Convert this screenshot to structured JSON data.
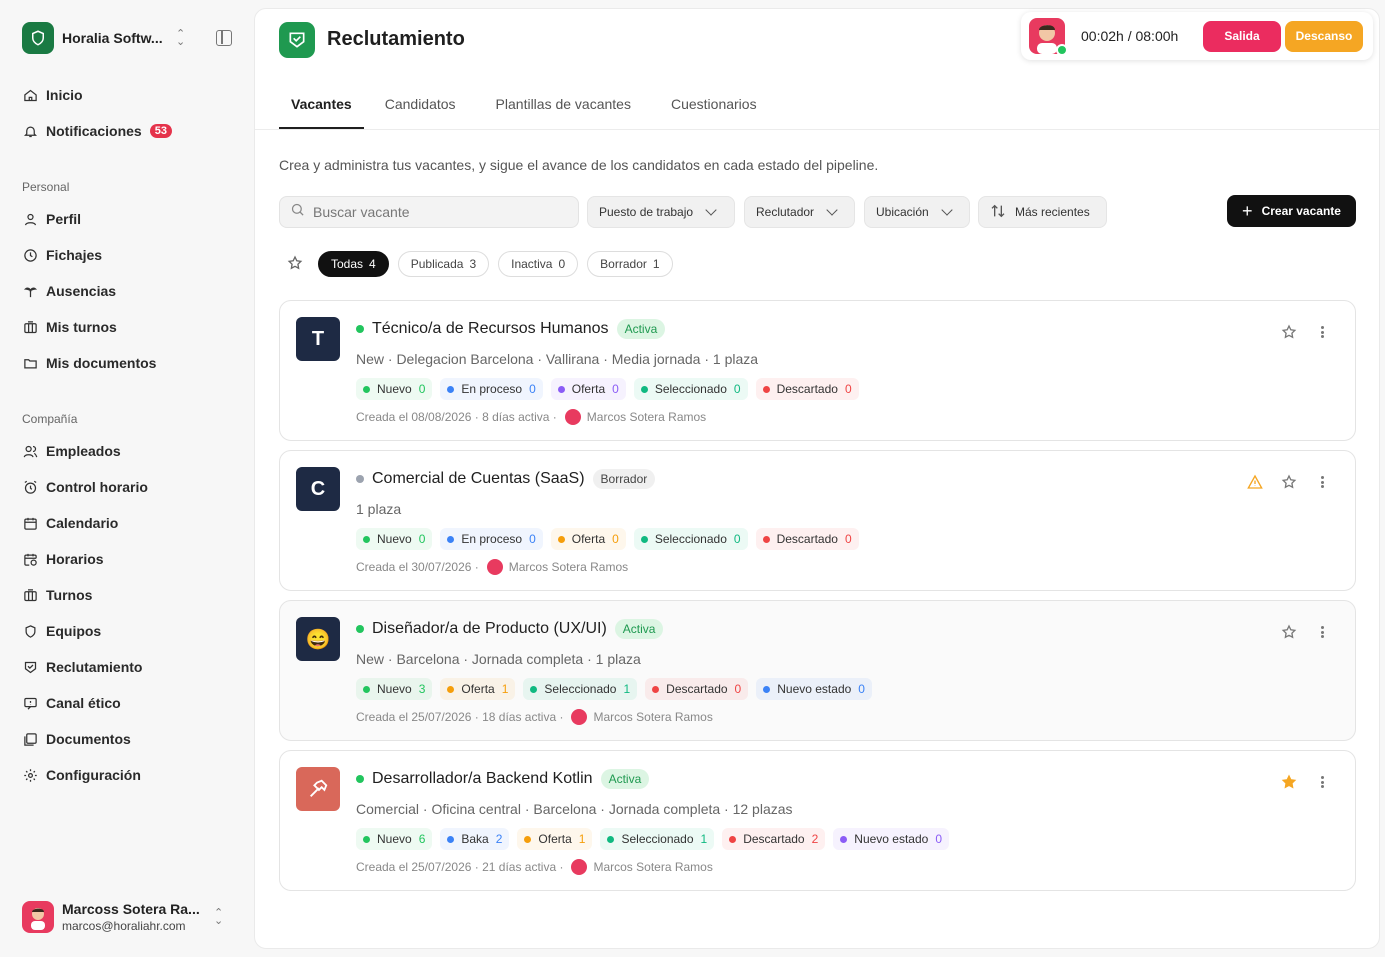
{
  "sidebar": {
    "workspace": "Horalia Softw...",
    "nav_top": [
      {
        "label": "Inicio",
        "icon": "home-icon"
      },
      {
        "label": "Notificaciones",
        "icon": "bell-icon",
        "badge": "53"
      }
    ],
    "section_personal": "Personal",
    "personal": [
      {
        "label": "Perfil",
        "icon": "user-icon"
      },
      {
        "label": "Fichajes",
        "icon": "clock-icon"
      },
      {
        "label": "Ausencias",
        "icon": "palm-tree-icon"
      },
      {
        "label": "Mis turnos",
        "icon": "shifts-icon"
      },
      {
        "label": "Mis documentos",
        "icon": "folder-icon"
      }
    ],
    "section_company": "Compañía",
    "company": [
      {
        "label": "Empleados",
        "icon": "users-icon"
      },
      {
        "label": "Control horario",
        "icon": "alarm-clock-icon"
      },
      {
        "label": "Calendario",
        "icon": "calendar-icon"
      },
      {
        "label": "Horarios",
        "icon": "calendar-clock-icon"
      },
      {
        "label": "Turnos",
        "icon": "shifts-icon"
      },
      {
        "label": "Equipos",
        "icon": "shield-icon"
      },
      {
        "label": "Reclutamiento",
        "icon": "handshake-icon"
      },
      {
        "label": "Canal ético",
        "icon": "message-icon"
      },
      {
        "label": "Documentos",
        "icon": "documents-icon"
      },
      {
        "label": "Configuración",
        "icon": "gear-icon"
      }
    ],
    "user": {
      "name": "Marcoss Sotera Ra...",
      "email": "marcos@horaliahr.com"
    }
  },
  "header": {
    "title": "Reclutamiento",
    "timer": "00:02h / 08:00h",
    "salida": "Salida",
    "descanso": "Descanso"
  },
  "tabs": [
    "Vacantes",
    "Candidatos",
    "Plantillas de vacantes",
    "Cuestionarios"
  ],
  "description": "Crea y administra tus vacantes, y sigue el avance de los candidatos en cada estado del pipeline.",
  "toolbar": {
    "search_placeholder": "Buscar vacante",
    "filters": [
      "Puesto de trabajo",
      "Reclutador",
      "Ubicación"
    ],
    "sort": "Más recientes",
    "create": "Crear vacante"
  },
  "chips": [
    {
      "label": "Todas",
      "count": "4"
    },
    {
      "label": "Publicada",
      "count": "3"
    },
    {
      "label": "Inactiva",
      "count": "0"
    },
    {
      "label": "Borrador",
      "count": "1"
    }
  ],
  "colors": {
    "accent": "#1f9950",
    "salida": "#eb2c5f",
    "descanso": "#f5a623",
    "active_dot": "#22c55e",
    "draft_dot": "#9ca3af"
  },
  "vacancies": [
    {
      "avatar": "T",
      "avatar_bg": "#1e2a44",
      "title": "Técnico/a de Recursos Humanos",
      "status": "Activa",
      "meta": "New · Delegacion Barcelona · Vallirana · Media jornada · 1 plaza",
      "stages": [
        {
          "label": "Nuevo",
          "count": "0",
          "color": "#22c55e"
        },
        {
          "label": "En proceso",
          "count": "0",
          "color": "#3b82f6"
        },
        {
          "label": "Oferta",
          "count": "0",
          "color": "#8b5cf6"
        },
        {
          "label": "Seleccionado",
          "count": "0",
          "color": "#10b981"
        },
        {
          "label": "Descartado",
          "count": "0",
          "color": "#ef4444"
        }
      ],
      "created": "Creada el 08/08/2026 · 8 días activa ·",
      "recruiter": "Marcos Sotera Ramos",
      "favorite": false,
      "warning": false
    },
    {
      "avatar": "C",
      "avatar_bg": "#1e2a44",
      "title": "Comercial de Cuentas (SaaS)",
      "status": "Borrador",
      "meta": "1 plaza",
      "stages": [
        {
          "label": "Nuevo",
          "count": "0",
          "color": "#22c55e"
        },
        {
          "label": "En proceso",
          "count": "0",
          "color": "#3b82f6"
        },
        {
          "label": "Oferta",
          "count": "0",
          "color": "#f59e0b"
        },
        {
          "label": "Seleccionado",
          "count": "0",
          "color": "#10b981"
        },
        {
          "label": "Descartado",
          "count": "0",
          "color": "#ef4444"
        }
      ],
      "created": "Creada el 30/07/2026 ·",
      "recruiter": "Marcos Sotera Ramos",
      "favorite": false,
      "warning": true
    },
    {
      "avatar": "😄",
      "avatar_bg": "#1e2a44",
      "title": "Diseñador/a de Producto (UX/UI)",
      "status": "Activa",
      "meta": "New · Barcelona · Jornada completa · 1 plaza",
      "stages": [
        {
          "label": "Nuevo",
          "count": "3",
          "color": "#22c55e"
        },
        {
          "label": "Oferta",
          "count": "1",
          "color": "#f59e0b"
        },
        {
          "label": "Seleccionado",
          "count": "1",
          "color": "#10b981"
        },
        {
          "label": "Descartado",
          "count": "0",
          "color": "#ef4444"
        },
        {
          "label": "Nuevo estado",
          "count": "0",
          "color": "#3b82f6"
        }
      ],
      "created": "Creada el 25/07/2026 · 18 días activa ·",
      "recruiter": "Marcos Sotera Ramos",
      "favorite": false,
      "warning": false
    },
    {
      "avatar": "hammer",
      "avatar_bg": "#d9685a",
      "title": "Desarrollador/a Backend Kotlin",
      "status": "Activa",
      "meta": "Comercial · Oficina central · Barcelona · Jornada completa · 12 plazas",
      "stages": [
        {
          "label": "Nuevo",
          "count": "6",
          "color": "#22c55e"
        },
        {
          "label": "Baka",
          "count": "2",
          "color": "#3b82f6"
        },
        {
          "label": "Oferta",
          "count": "1",
          "color": "#f59e0b"
        },
        {
          "label": "Seleccionado",
          "count": "1",
          "color": "#10b981"
        },
        {
          "label": "Descartado",
          "count": "2",
          "color": "#ef4444"
        },
        {
          "label": "Nuevo estado",
          "count": "0",
          "color": "#8b5cf6"
        }
      ],
      "created": "Creada el 25/07/2026 · 21 días activa ·",
      "recruiter": "Marcos Sotera Ramos",
      "favorite": true,
      "warning": false
    }
  ]
}
